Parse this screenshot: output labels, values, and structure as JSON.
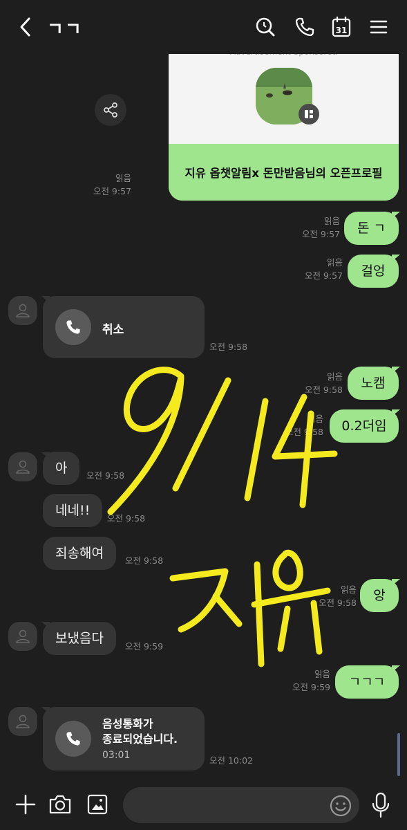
{
  "header": {
    "title": "ㄱㄱ",
    "icons": [
      "back-arrow-icon",
      "search-icon",
      "phone-icon",
      "calendar-icon",
      "menu-icon"
    ],
    "calendar_day": "31"
  },
  "profile_card": {
    "top_label": "Advertisement Sponsored",
    "title": "지유 옵챗알림x 돈만받음님의 오픈프로필",
    "read": "읽음",
    "time": "오전 9:57",
    "color": "#9ee58e"
  },
  "messages": [
    {
      "side": "out",
      "text": "돈 ㄱ",
      "read": "읽음",
      "time": "오전 9:57"
    },
    {
      "side": "out",
      "text": "걸엉",
      "read": "읽음",
      "time": "오전 9:57"
    },
    {
      "side": "in",
      "type": "call",
      "text": "취소",
      "time": "오전 9:58"
    },
    {
      "side": "out",
      "text": "노캠",
      "read": "읽음",
      "time": "오전 9:58"
    },
    {
      "side": "out",
      "text": "0.2더임",
      "read": "읽음",
      "time": "오전 9:58"
    },
    {
      "side": "in",
      "text": "아",
      "time": "오전 9:58"
    },
    {
      "side": "in",
      "text": "네네!!",
      "time": "오전 9:58"
    },
    {
      "side": "in",
      "text": "죄송해여",
      "time": "오전 9:58"
    },
    {
      "side": "out",
      "text": "앙",
      "read": "읽음",
      "time": "오전 9:58"
    },
    {
      "side": "in",
      "text": "보냈음다",
      "time": "오전 9:59"
    },
    {
      "side": "out",
      "text": "ㄱㄱㄱ",
      "read": "읽음",
      "time": "오전 9:59"
    },
    {
      "side": "in",
      "type": "call",
      "text_line1": "음성통화가",
      "text_line2": "종료되었습니다.",
      "duration": "03:01",
      "time": "오전 10:02"
    }
  ],
  "handwriting": {
    "line1": "9/14",
    "line2": "지유",
    "color": "#f4ea1e"
  },
  "bottom_bar": {
    "icons": [
      "plus-icon",
      "camera-icon",
      "gallery-icon",
      "emoji-icon",
      "microphone-icon"
    ],
    "input_placeholder": ""
  },
  "colors": {
    "background": "#1e1e1e",
    "bubble_out": "#9ee58e",
    "bubble_in": "#353535"
  }
}
